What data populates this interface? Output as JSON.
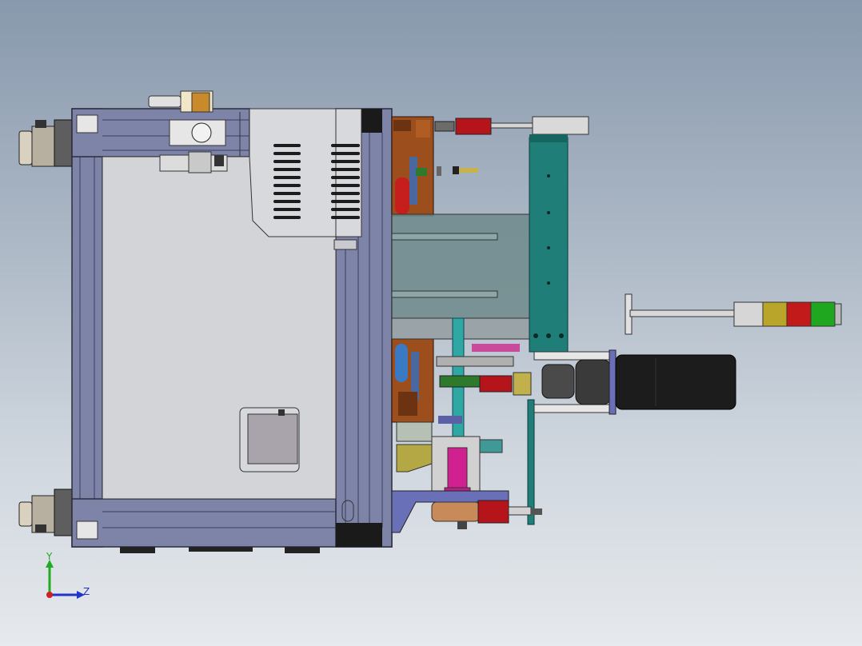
{
  "app": {
    "view": "cad-3d-model-viewport"
  },
  "triad": {
    "y_label": "Y",
    "z_label": "Z",
    "x_color": "#cc2222",
    "y_color": "#22aa22",
    "z_color": "#2233cc"
  },
  "colors": {
    "frame": "#7e84a8",
    "frame_dark": "#2c2c3c",
    "panel": "#d3d4d8",
    "teal": "#1f7e78",
    "amber_block": "#9c4e1c",
    "motor_black": "#1c1c1c",
    "signal_yellow": "#b8a52a",
    "signal_red": "#c21a1a",
    "signal_green": "#1fa81f"
  },
  "parts": [
    "assembly-frame",
    "housing-panel",
    "vent-cover",
    "access-hatch",
    "leveling-foot-top",
    "leveling-foot-bottom",
    "top-cylinder-assembly",
    "amber-mechanism-block",
    "teal-vertical-rail",
    "servo-motor",
    "signal-tower-light",
    "bottom-cylinder",
    "magenta-press-column"
  ]
}
